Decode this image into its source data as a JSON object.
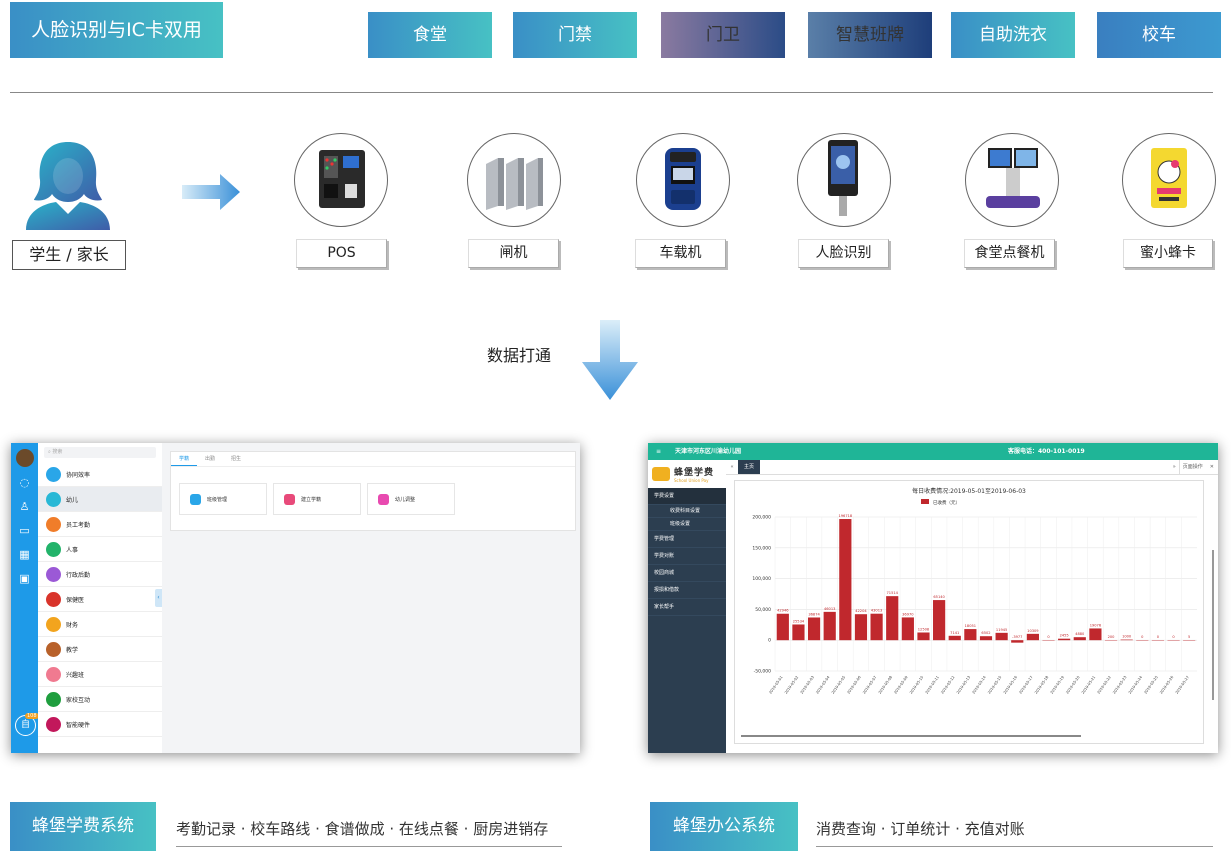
{
  "header": {
    "title": "人脸识别与IC卡双用",
    "tabs": [
      {
        "label": "食堂"
      },
      {
        "label": "门禁"
      },
      {
        "label": "门卫"
      },
      {
        "label": "智慧班牌"
      },
      {
        "label": "自助洗衣"
      },
      {
        "label": "校车"
      }
    ]
  },
  "user": {
    "label": "学生 / 家长"
  },
  "devices": [
    {
      "label": "POS"
    },
    {
      "label": "闸机"
    },
    {
      "label": "车载机"
    },
    {
      "label": "人脸识别"
    },
    {
      "label": "食堂点餐机"
    },
    {
      "label": "蜜小蜂卡"
    }
  ],
  "flow": {
    "label": "数据打通"
  },
  "left_app": {
    "search_placeholder": "搜索",
    "menu": [
      {
        "label": "协同效率",
        "color": "#2aa6e8"
      },
      {
        "label": "幼儿",
        "color": "#28b8d6"
      },
      {
        "label": "员工考勤",
        "color": "#f07d2a"
      },
      {
        "label": "人事",
        "color": "#22b36a"
      },
      {
        "label": "行政后勤",
        "color": "#9b59d6"
      },
      {
        "label": "保健医",
        "color": "#d9342b"
      },
      {
        "label": "财务",
        "color": "#f2a41e"
      },
      {
        "label": "教学",
        "color": "#b8612a"
      },
      {
        "label": "兴趣班",
        "color": "#f07a90"
      },
      {
        "label": "家校互动",
        "color": "#1f9e3e"
      },
      {
        "label": "智能硬件",
        "color": "#c2185b"
      }
    ],
    "tabs": [
      {
        "label": "学籍"
      },
      {
        "label": "出勤"
      },
      {
        "label": "招生"
      }
    ],
    "cards": [
      {
        "label": "班级管理",
        "color": "#2aa6e8"
      },
      {
        "label": "建立学籍",
        "color": "#e84a7a"
      },
      {
        "label": "幼儿调整",
        "color": "#e84ab0"
      }
    ],
    "badge": "108"
  },
  "right_app": {
    "org": "天津市河东区川渝幼儿园",
    "hotline": "客服电话：400-101-0019",
    "brand": "蜂堡学费",
    "brand_en": "School Union Pay",
    "tab": "主页",
    "page_ops": "页面操作",
    "sidebar": [
      {
        "label": "学费设置"
      },
      {
        "label": "收费科目设置"
      },
      {
        "label": "班级设置"
      },
      {
        "label": "学费管理"
      },
      {
        "label": "学费对账"
      },
      {
        "label": "校园商城"
      },
      {
        "label": "报损和借款"
      },
      {
        "label": "家长帮手"
      }
    ]
  },
  "chart_data": {
    "type": "bar",
    "title": "每日收费情况:2019-05-01至2019-06-03",
    "series": [
      {
        "name": "已收费（元）",
        "values": [
          42946,
          25534,
          36874,
          46013,
          196718,
          42204,
          43013,
          71514,
          36970,
          12508,
          65140,
          7141,
          18051,
          6502,
          11945,
          -3977,
          10309,
          0,
          2455,
          4880,
          19076,
          200,
          1000,
          0,
          0,
          0,
          5
        ]
      }
    ],
    "categories": [
      "2019-05-01",
      "2019-05-02",
      "2019-05-03",
      "2019-05-04",
      "2019-05-05",
      "2019-05-06",
      "2019-05-07",
      "2019-05-08",
      "2019-05-09",
      "2019-05-10",
      "2019-05-11",
      "2019-05-12",
      "2019-05-13",
      "2019-05-14",
      "2019-05-15",
      "2019-05-16",
      "2019-05-17",
      "2019-05-18",
      "2019-05-19",
      "2019-05-20",
      "2019-05-21",
      "2019-05-22",
      "2019-05-23",
      "2019-05-24",
      "2019-05-25",
      "2019-05-26",
      "2019-05-27"
    ],
    "yticks": [
      "200,000",
      "150,000",
      "100,000",
      "50,000",
      "0",
      "-50,000"
    ],
    "ylim": [
      -50000,
      200000
    ],
    "color": "#c0282d"
  },
  "systems": [
    {
      "name": "蜂堡学费系统",
      "desc": "考勤记录 · 校车路线 · 食谱做成 · 在线点餐 · 厨房进销存"
    },
    {
      "name": "蜂堡办公系统",
      "desc": "消费查询 · 订单统计 · 充值对账"
    }
  ]
}
